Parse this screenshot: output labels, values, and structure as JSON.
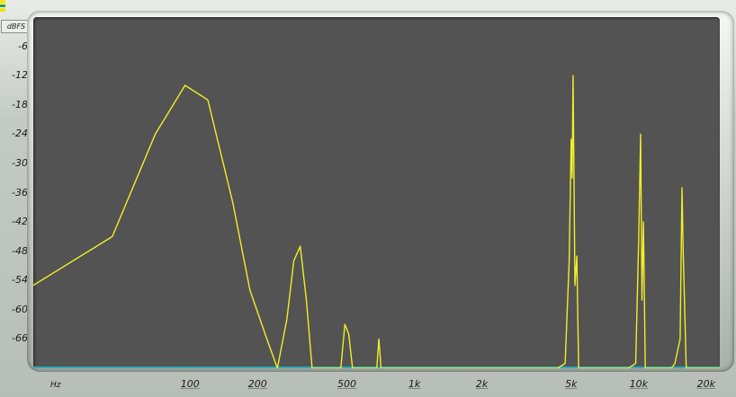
{
  "indicator": {
    "colors": [
      "#f1e417",
      "#2fa030",
      "#f1e417"
    ]
  },
  "y_axis": {
    "unit_label": "dBFS",
    "ticks": [
      "-6",
      "-12",
      "-18",
      "-24",
      "-30",
      "-36",
      "-42",
      "-48",
      "-54",
      "-60",
      "-66"
    ]
  },
  "x_axis": {
    "unit_label": "Hz",
    "ticks": [
      "100",
      "200",
      "500",
      "1k",
      "2k",
      "5k",
      "10k",
      "20k"
    ]
  },
  "colors": {
    "plot_bg": "#535353",
    "trace": "#f0ee27",
    "baseline": "#2ea8b5"
  },
  "chart_data": {
    "type": "line",
    "xscale": "log",
    "xlim": [
      20,
      23000
    ],
    "ylim": [
      -72,
      0
    ],
    "xlabel": "Hz",
    "ylabel": "dBFS",
    "series": [
      {
        "x": [
          20,
          45,
          70,
          95,
          120,
          155,
          185,
          220,
          245,
          270,
          290,
          310,
          330,
          350,
          470,
          490,
          510,
          530,
          680,
          695,
          710,
          4350,
          4700,
          4900,
          5000,
          5050,
          5100,
          5150,
          5200,
          5300,
          5400,
          5600,
          5800,
          9000,
          9700,
          10000,
          10200,
          10350,
          10500,
          10700,
          11200,
          14000,
          14500,
          15300,
          15600,
          15800,
          16300,
          23000
        ],
        "y": [
          -55,
          -45,
          -24,
          -14,
          -17,
          -38,
          -56,
          -66,
          -72,
          -62,
          -50,
          -47,
          -58,
          -72,
          -72,
          -63,
          -65,
          -72,
          -72,
          -66,
          -72,
          -72,
          -71,
          -50,
          -25,
          -33,
          -12,
          -34,
          -55,
          -49,
          -72,
          -72,
          -72,
          -72,
          -71,
          -46,
          -24,
          -58,
          -42,
          -72,
          -72,
          -72,
          -71,
          -66,
          -35,
          -48,
          -72,
          -72
        ]
      }
    ]
  }
}
